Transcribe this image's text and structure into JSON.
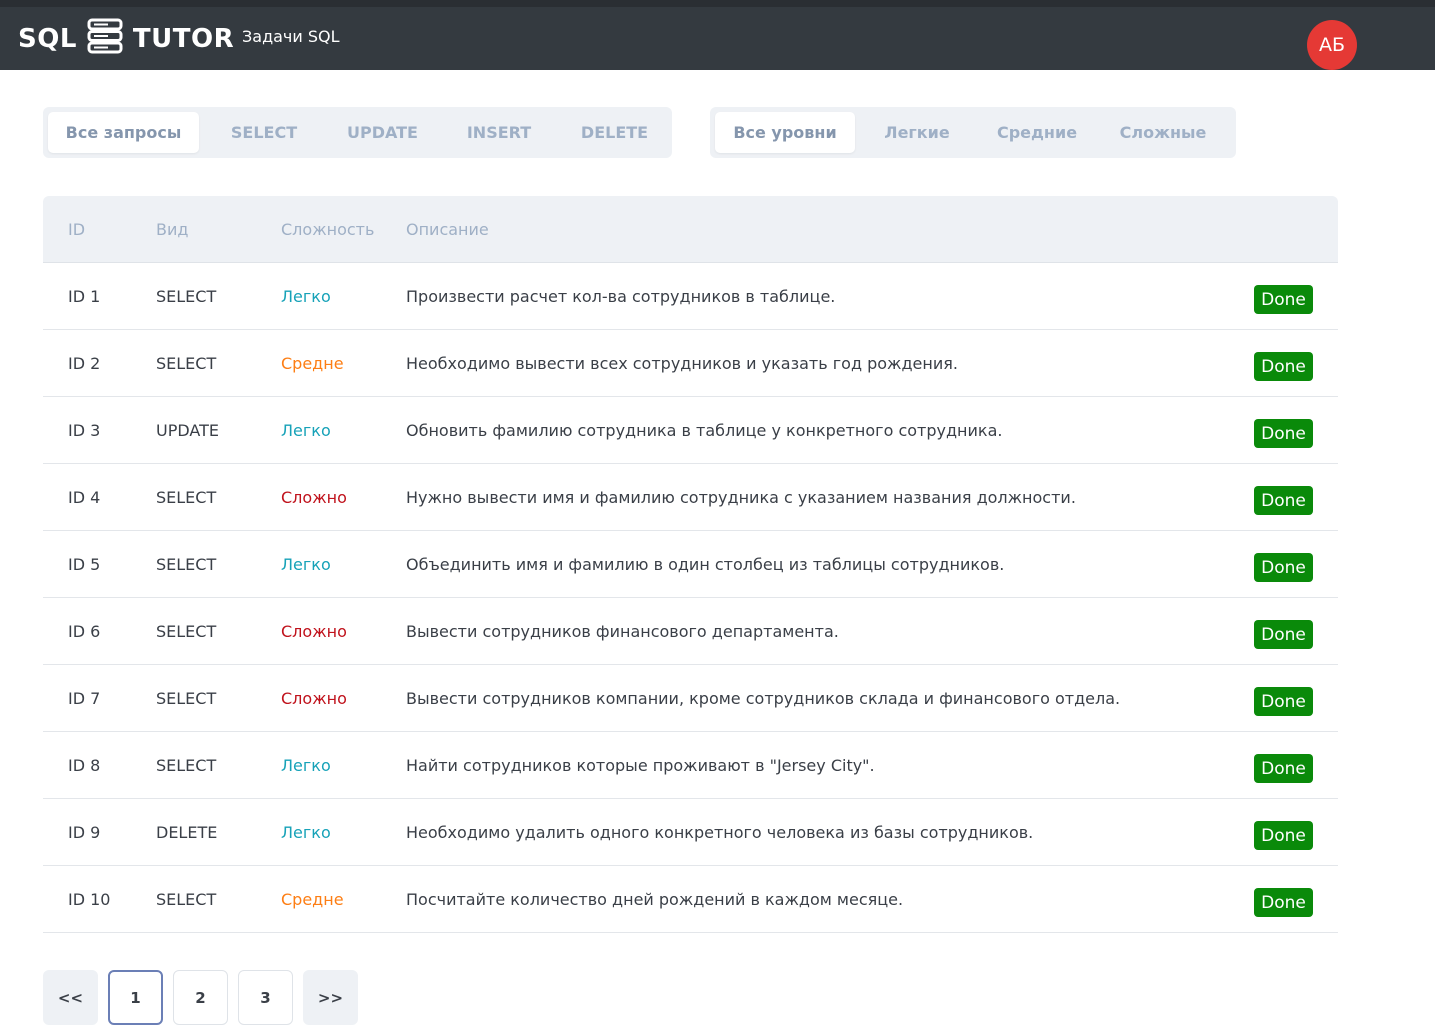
{
  "header": {
    "logo_left": "SQL",
    "logo_right": "TUTOR",
    "nav_link": "Задачи SQL",
    "avatar_initials": "АБ",
    "avatar_color": "#e53935"
  },
  "filters": {
    "query_types": [
      "Все запросы",
      "SELECT",
      "UPDATE",
      "INSERT",
      "DELETE"
    ],
    "query_types_active": "Все запросы",
    "levels": [
      "Все уровни",
      "Легкие",
      "Средние",
      "Сложные"
    ],
    "levels_active": "Все уровни"
  },
  "table": {
    "columns": [
      "ID",
      "Вид",
      "Сложность",
      "Описание"
    ],
    "rows": [
      {
        "id": "ID 1",
        "kind": "SELECT",
        "difficulty": "Легко",
        "level": "easy",
        "description": "Произвести расчет кол-ва сотрудников в таблице.",
        "status": "Done"
      },
      {
        "id": "ID 2",
        "kind": "SELECT",
        "difficulty": "Средне",
        "level": "mid",
        "description": "Необходимо вывести всех сотрудников и указать год рождения.",
        "status": "Done"
      },
      {
        "id": "ID 3",
        "kind": "UPDATE",
        "difficulty": "Легко",
        "level": "easy",
        "description": "Обновить фамилию сотрудника в таблице у конкретного сотрудника.",
        "status": "Done"
      },
      {
        "id": "ID 4",
        "kind": "SELECT",
        "difficulty": "Сложно",
        "level": "hard",
        "description": "Нужно вывести имя и фамилию сотрудника с указанием названия должности.",
        "status": "Done"
      },
      {
        "id": "ID 5",
        "kind": "SELECT",
        "difficulty": "Легко",
        "level": "easy",
        "description": "Объединить имя и фамилию в один столбец из таблицы сотрудников.",
        "status": "Done"
      },
      {
        "id": "ID 6",
        "kind": "SELECT",
        "difficulty": "Сложно",
        "level": "hard",
        "description": "Вывести сотрудников финансового департамента.",
        "status": "Done"
      },
      {
        "id": "ID 7",
        "kind": "SELECT",
        "difficulty": "Сложно",
        "level": "hard",
        "description": "Вывести сотрудников компании, кроме сотрудников склада и финансового отдела.",
        "status": "Done"
      },
      {
        "id": "ID 8",
        "kind": "SELECT",
        "difficulty": "Легко",
        "level": "easy",
        "description": "Найти сотрудников которые проживают в \"Jersey City\".",
        "status": "Done"
      },
      {
        "id": "ID 9",
        "kind": "DELETE",
        "difficulty": "Легко",
        "level": "easy",
        "description": "Необходимо удалить одного конкретного человека из базы сотрудников.",
        "status": "Done"
      },
      {
        "id": "ID 10",
        "kind": "SELECT",
        "difficulty": "Средне",
        "level": "mid",
        "description": "Посчитайте количество дней рождений в каждом месяце.",
        "status": "Done"
      }
    ]
  },
  "pagination": {
    "prev": "<<",
    "pages": [
      "1",
      "2",
      "3"
    ],
    "current": "1",
    "next": ">>"
  },
  "colors": {
    "easy": "#17a2b8",
    "mid": "#fd7e14",
    "hard": "#c0121c",
    "done": "#0a8a0a"
  }
}
